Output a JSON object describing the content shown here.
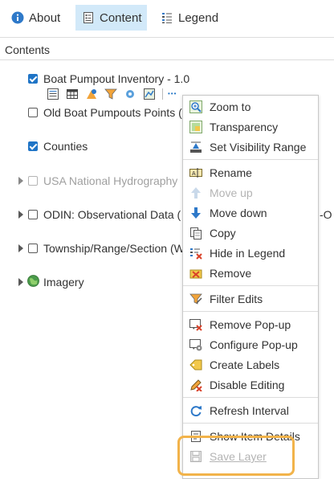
{
  "tabs": {
    "about": "About",
    "content": "Content",
    "legend": "Legend"
  },
  "contents_title": "Contents",
  "layers": {
    "boat_pumpout": "Boat Pumpout Inventory - 1.0",
    "old_boat": "Old Boat Pumpouts Points (",
    "counties": "Counties",
    "usa_hydro": "USA National Hydrography",
    "odin": "ODIN: Observational Data (",
    "odin_tail": "-O",
    "township": "Township/Range/Section (W",
    "imagery": "Imagery"
  },
  "menu": {
    "zoom_to": "Zoom to",
    "transparency": "Transparency",
    "set_visibility_range": "Set Visibility Range",
    "rename": "Rename",
    "move_up": "Move up",
    "move_down": "Move down",
    "copy": "Copy",
    "hide_in_legend": "Hide in Legend",
    "remove": "Remove",
    "filter_edits": "Filter Edits",
    "remove_popup": "Remove Pop-up",
    "configure_popup": "Configure Pop-up",
    "create_labels": "Create Labels",
    "disable_editing": "Disable Editing",
    "refresh_interval": "Refresh Interval",
    "show_item_details": "Show Item Details",
    "save_layer": "Save Layer"
  },
  "more_glyph": "•••",
  "colors": {
    "accent": "#1f74c6",
    "tab_active_bg": "#d2e9f9",
    "highlight": "#f2b34a",
    "disabled_text": "#b4b4b4"
  }
}
